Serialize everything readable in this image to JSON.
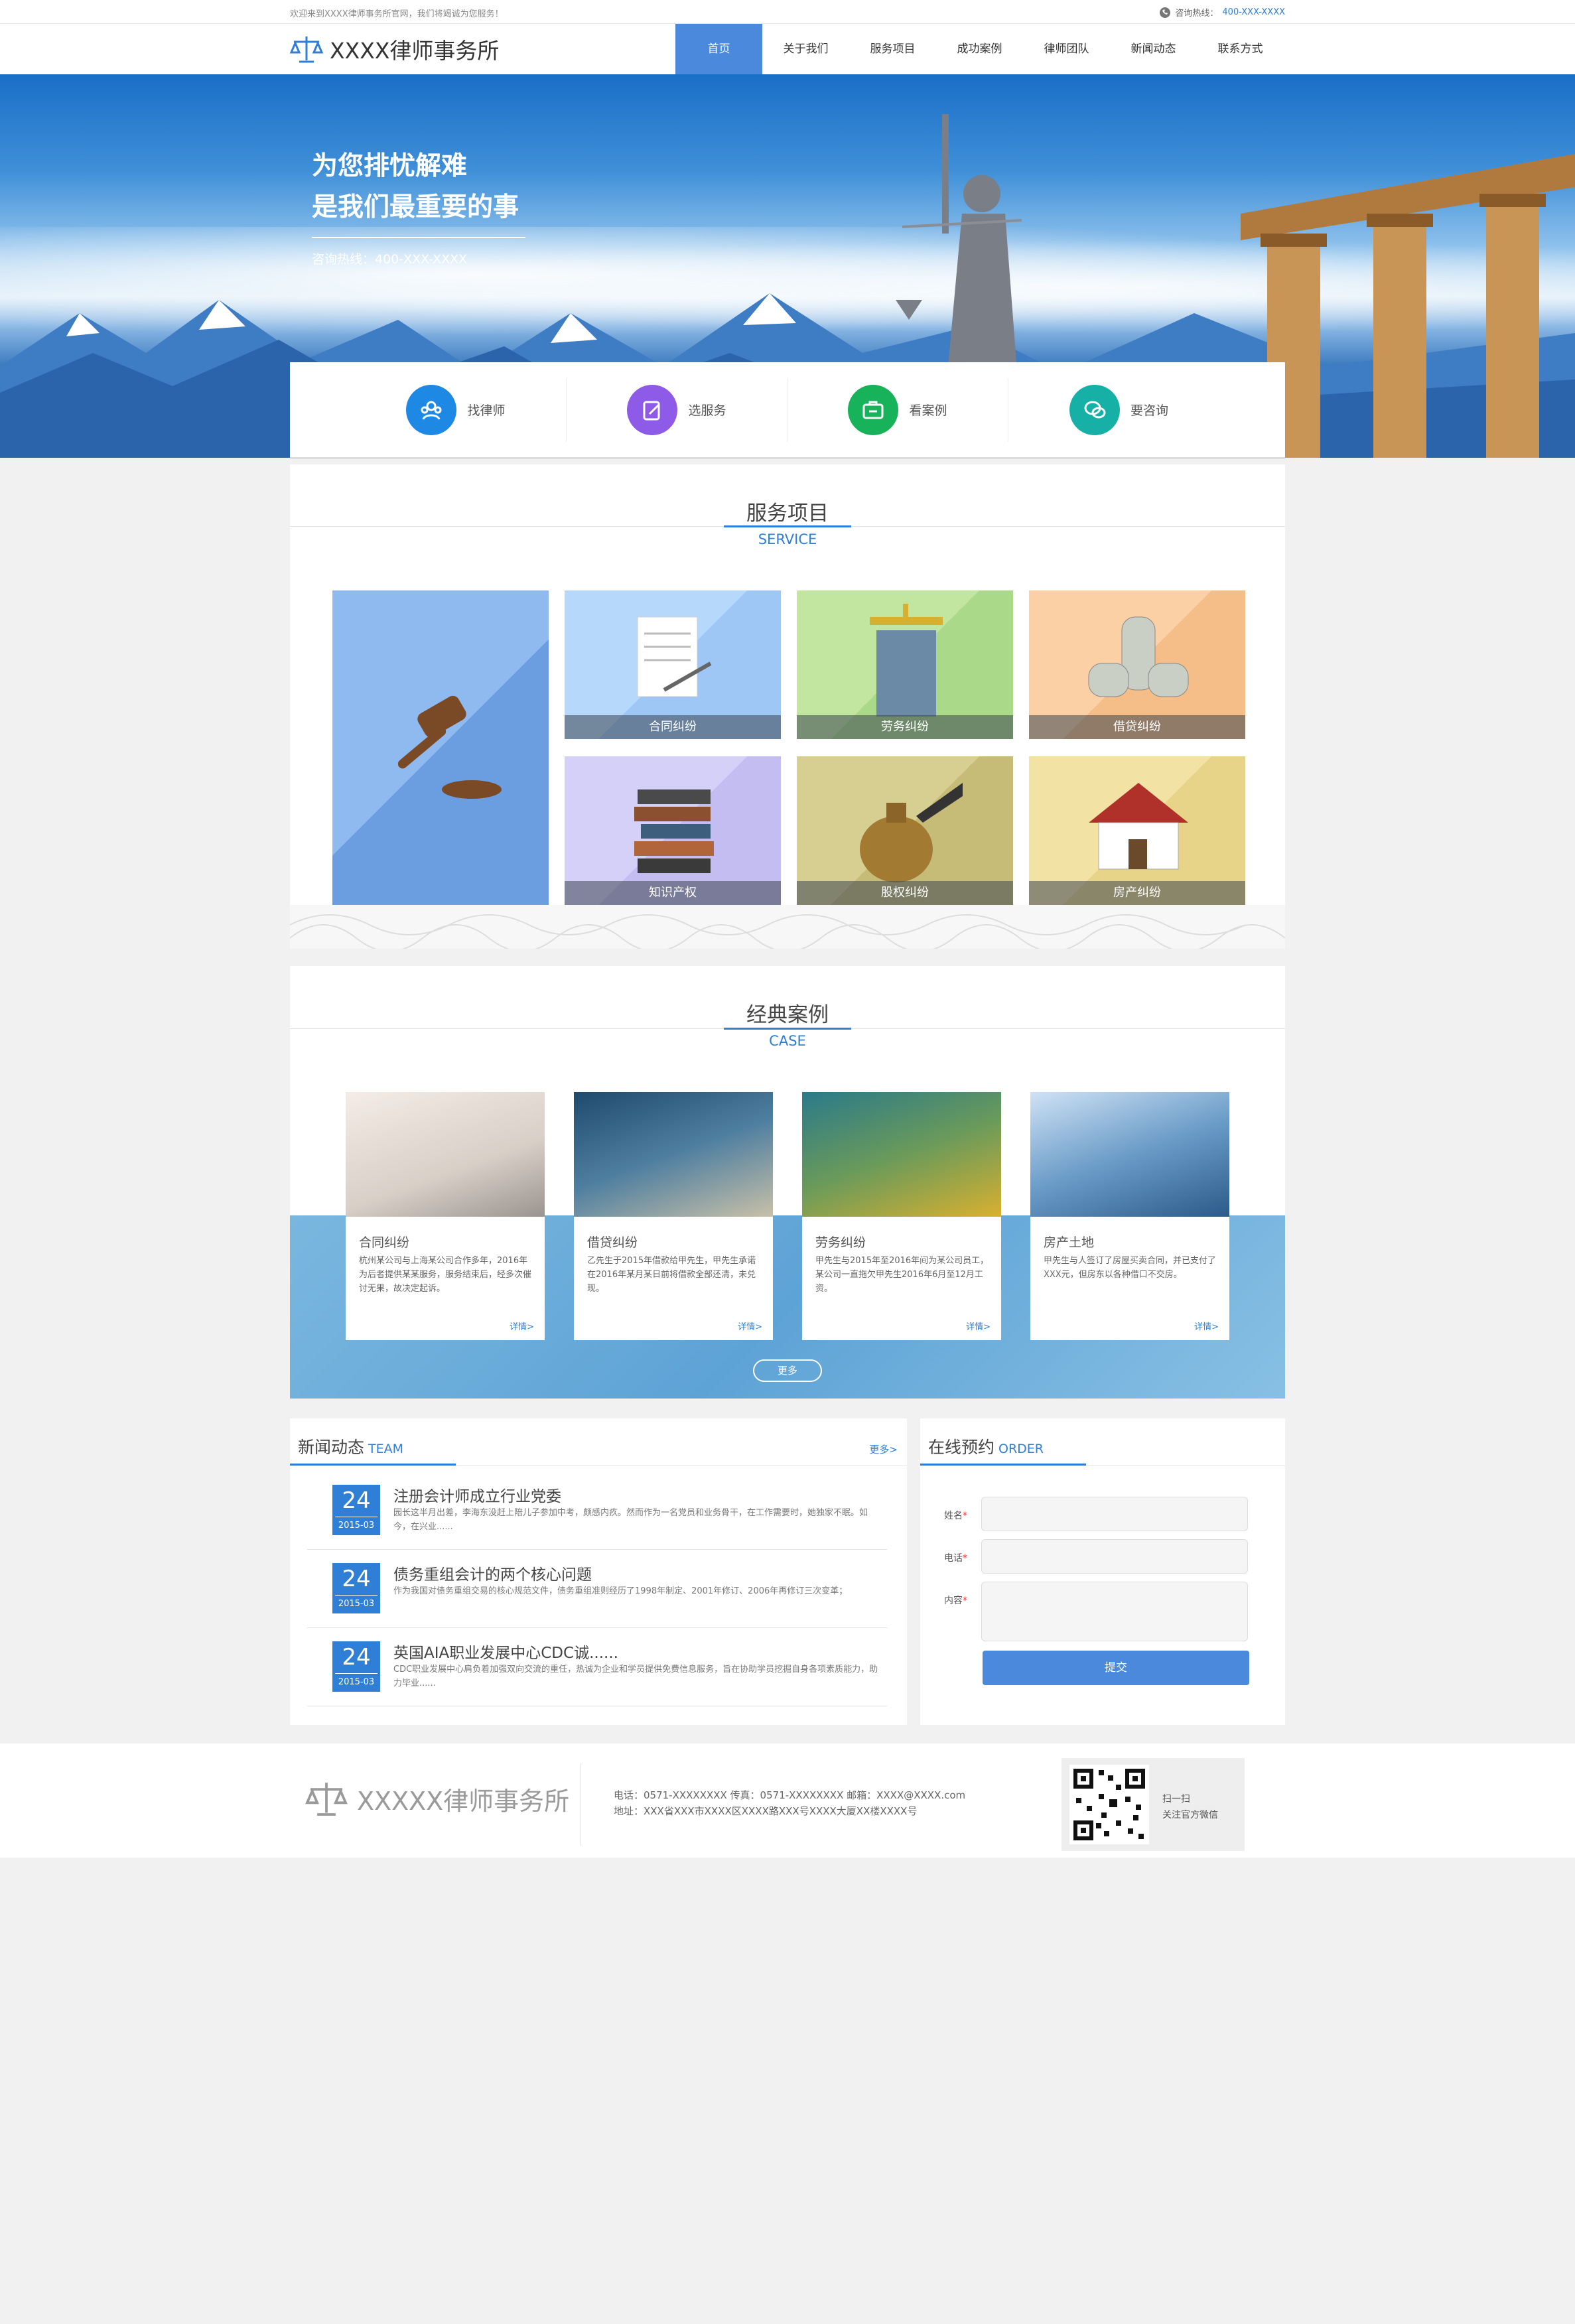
{
  "topbar": {
    "welcome": "欢迎来到XXXX律师事务所官网，我们将竭诚为您服务！",
    "hotline_label": "咨询热线：",
    "hotline_number": "400-XXX-XXXX"
  },
  "header": {
    "logo_text": "XXXX律师事务所",
    "nav": [
      "首页",
      "关于我们",
      "服务项目",
      "成功案例",
      "律师团队",
      "新闻动态",
      "联系方式"
    ]
  },
  "banner": {
    "line1": "为您排忧解难",
    "line2": "是我们最重要的事",
    "phone": "咨询热线：400-XXX-XXXX"
  },
  "quick_links": [
    {
      "label": "找律师",
      "icon": "people-icon",
      "color": "#1e88e5"
    },
    {
      "label": "选服务",
      "icon": "pen-icon",
      "color": "#8e5be8"
    },
    {
      "label": "看案例",
      "icon": "briefcase-icon",
      "color": "#18b25a"
    },
    {
      "label": "要咨询",
      "icon": "chat-icon",
      "color": "#16b0a6"
    }
  ],
  "services": {
    "title_cn": "服务项目",
    "title_en": "SERVICE",
    "items": [
      "合同纠纷",
      "劳务纠纷",
      "借贷纠纷",
      "知识产权",
      "股权纠纷",
      "房产纠纷"
    ]
  },
  "cases": {
    "title_cn": "经典案例",
    "title_en": "CASE",
    "more_label": "更多",
    "detail_label": "详情>",
    "items": [
      {
        "title": "合同纠纷",
        "desc": "杭州某公司与上海某公司合作多年，2016年为后者提供某某服务，服务结束后，经多次催讨无果，故决定起诉。"
      },
      {
        "title": "借贷纠纷",
        "desc": "乙先生于2015年借款给甲先生，甲先生承诺在2016年某月某日前将借款全部还清，未兑现。"
      },
      {
        "title": "劳务纠纷",
        "desc": "甲先生与2015年至2016年间为某公司员工，某公司一直拖欠甲先生2016年6月至12月工资。"
      },
      {
        "title": "房产土地",
        "desc": "甲先生与人签订了房屋买卖合同，并已支付了XXX元，但房东以各种借口不交房。"
      }
    ]
  },
  "news": {
    "title_cn": "新闻动态",
    "title_en": "TEAM",
    "more_label": "更多>",
    "items": [
      {
        "day": "24",
        "ym": "2015-03",
        "title": "注册会计师成立行业党委",
        "desc": "园长这半月出差，李海东没赶上陪儿子参加中考，颇感内疚。然而作为一名党员和业务骨干，在工作需要时，她独家不眠。如今，在兴业......"
      },
      {
        "day": "24",
        "ym": "2015-03",
        "title": "债务重组会计的两个核心问题",
        "desc": "作为我国对债务重组交易的核心规范文件，债务重组准则经历了1998年制定、2001年修订、2006年再修订三次变革；"
      },
      {
        "day": "24",
        "ym": "2015-03",
        "title": "英国AIA职业发展中心CDC诚......",
        "desc": "CDC职业发展中心肩负着加强双向交流的重任，热诚为企业和学员提供免费信息服务，旨在协助学员挖掘自身各项素质能力，助力毕业......"
      }
    ]
  },
  "order": {
    "title_cn": "在线预约",
    "title_en": "ORDER",
    "name_label": "姓名",
    "phone_label": "电话",
    "content_label": "内容",
    "required_mark": "*",
    "submit_label": "提交"
  },
  "footer": {
    "logo_text": "XXXXX律师事务所",
    "contact_line": "电话：0571-XXXXXXXX 传真：0571-XXXXXXXX 邮箱：XXXX@XXXX.com",
    "address_line": "地址：XXX省XXX市XXXX区XXXX路XXX号XXXX大厦XX楼XXXX号",
    "qr_line1": "扫一扫",
    "qr_line2": "关注官方微信"
  }
}
